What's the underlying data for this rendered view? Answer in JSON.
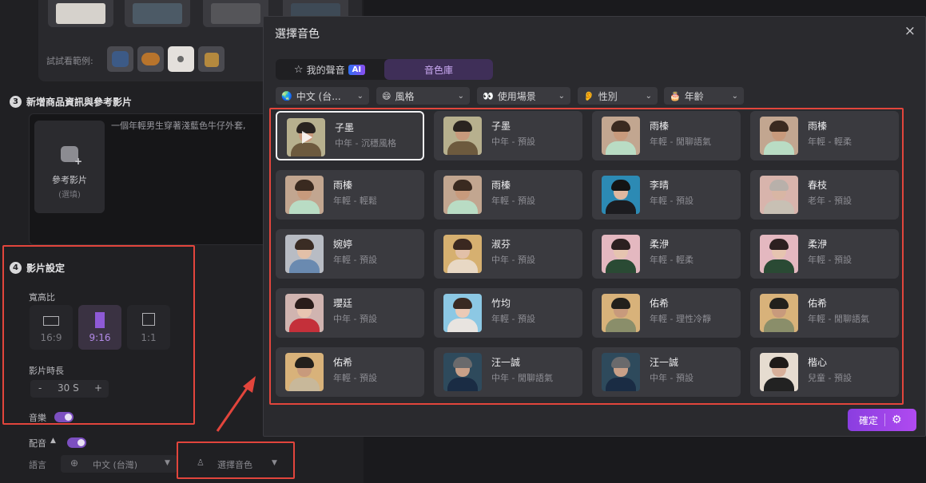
{
  "left": {
    "try_label": "試試看範例:",
    "section3": {
      "num": "3",
      "title": "新增商品資訊與參考影片"
    },
    "reference": {
      "title": "參考影片",
      "sub": "(選填)"
    },
    "prompt_text": "一個年輕男生穿著淺藍色牛仔外套,",
    "section4": {
      "num": "4",
      "title": "影片設定"
    },
    "aspect_label": "寬高比",
    "ratios": [
      {
        "label": "16:9"
      },
      {
        "label": "9:16"
      },
      {
        "label": "1:1"
      }
    ],
    "duration_label": "影片時長",
    "duration": {
      "minus": "-",
      "value": "30 S",
      "plus": "+"
    },
    "music_label": "音樂",
    "dub_label": "配音",
    "lang_label": "語言",
    "lang_value": "中文 (台灣)",
    "voice_select": "選擇音色"
  },
  "dialog": {
    "title": "選擇音色",
    "close": "×",
    "tab_mine": "我的聲音",
    "ai_badge": "AI",
    "tab_library": "音色庫",
    "filters": [
      {
        "icon": "🌏",
        "label": "中文 (台..."
      },
      {
        "icon": "😄",
        "label": "風格"
      },
      {
        "icon": "👀",
        "label": "使用場景"
      },
      {
        "icon": "👂",
        "label": "性別"
      },
      {
        "icon": "🎂",
        "label": "年齡"
      }
    ],
    "voices": [
      {
        "name": "子墨",
        "desc": "中年 - 沉穩風格"
      },
      {
        "name": "子墨",
        "desc": "中年 - 預設"
      },
      {
        "name": "雨榛",
        "desc": "年輕 - 閒聊語氣"
      },
      {
        "name": "雨榛",
        "desc": "年輕 - 輕柔"
      },
      {
        "name": "雨榛",
        "desc": "年輕 - 輕鬆"
      },
      {
        "name": "雨榛",
        "desc": "年輕 - 預設"
      },
      {
        "name": "李晴",
        "desc": "年輕 - 預設"
      },
      {
        "name": "春枝",
        "desc": "老年 - 預設"
      },
      {
        "name": "婉婷",
        "desc": "年輕 - 預設"
      },
      {
        "name": "淑芬",
        "desc": "中年 - 預設"
      },
      {
        "name": "柔洢",
        "desc": "年輕 - 輕柔"
      },
      {
        "name": "柔洢",
        "desc": "年輕 - 預設"
      },
      {
        "name": "瓔廷",
        "desc": "中年 - 預設"
      },
      {
        "name": "竹均",
        "desc": "年輕 - 預設"
      },
      {
        "name": "佑希",
        "desc": "年輕 - 理性冷靜"
      },
      {
        "name": "佑希",
        "desc": "年輕 - 閒聊語氣"
      },
      {
        "name": "佑希",
        "desc": "年輕 - 預設"
      },
      {
        "name": "汪一誠",
        "desc": "中年 - 閒聊語氣"
      },
      {
        "name": "汪一誠",
        "desc": "中年 - 預設"
      },
      {
        "name": "楷心",
        "desc": "兒童 - 預設"
      }
    ],
    "confirm": "確定"
  },
  "colors": {
    "accent": "#8a3ee0",
    "highlight_box": "#e2453c"
  }
}
